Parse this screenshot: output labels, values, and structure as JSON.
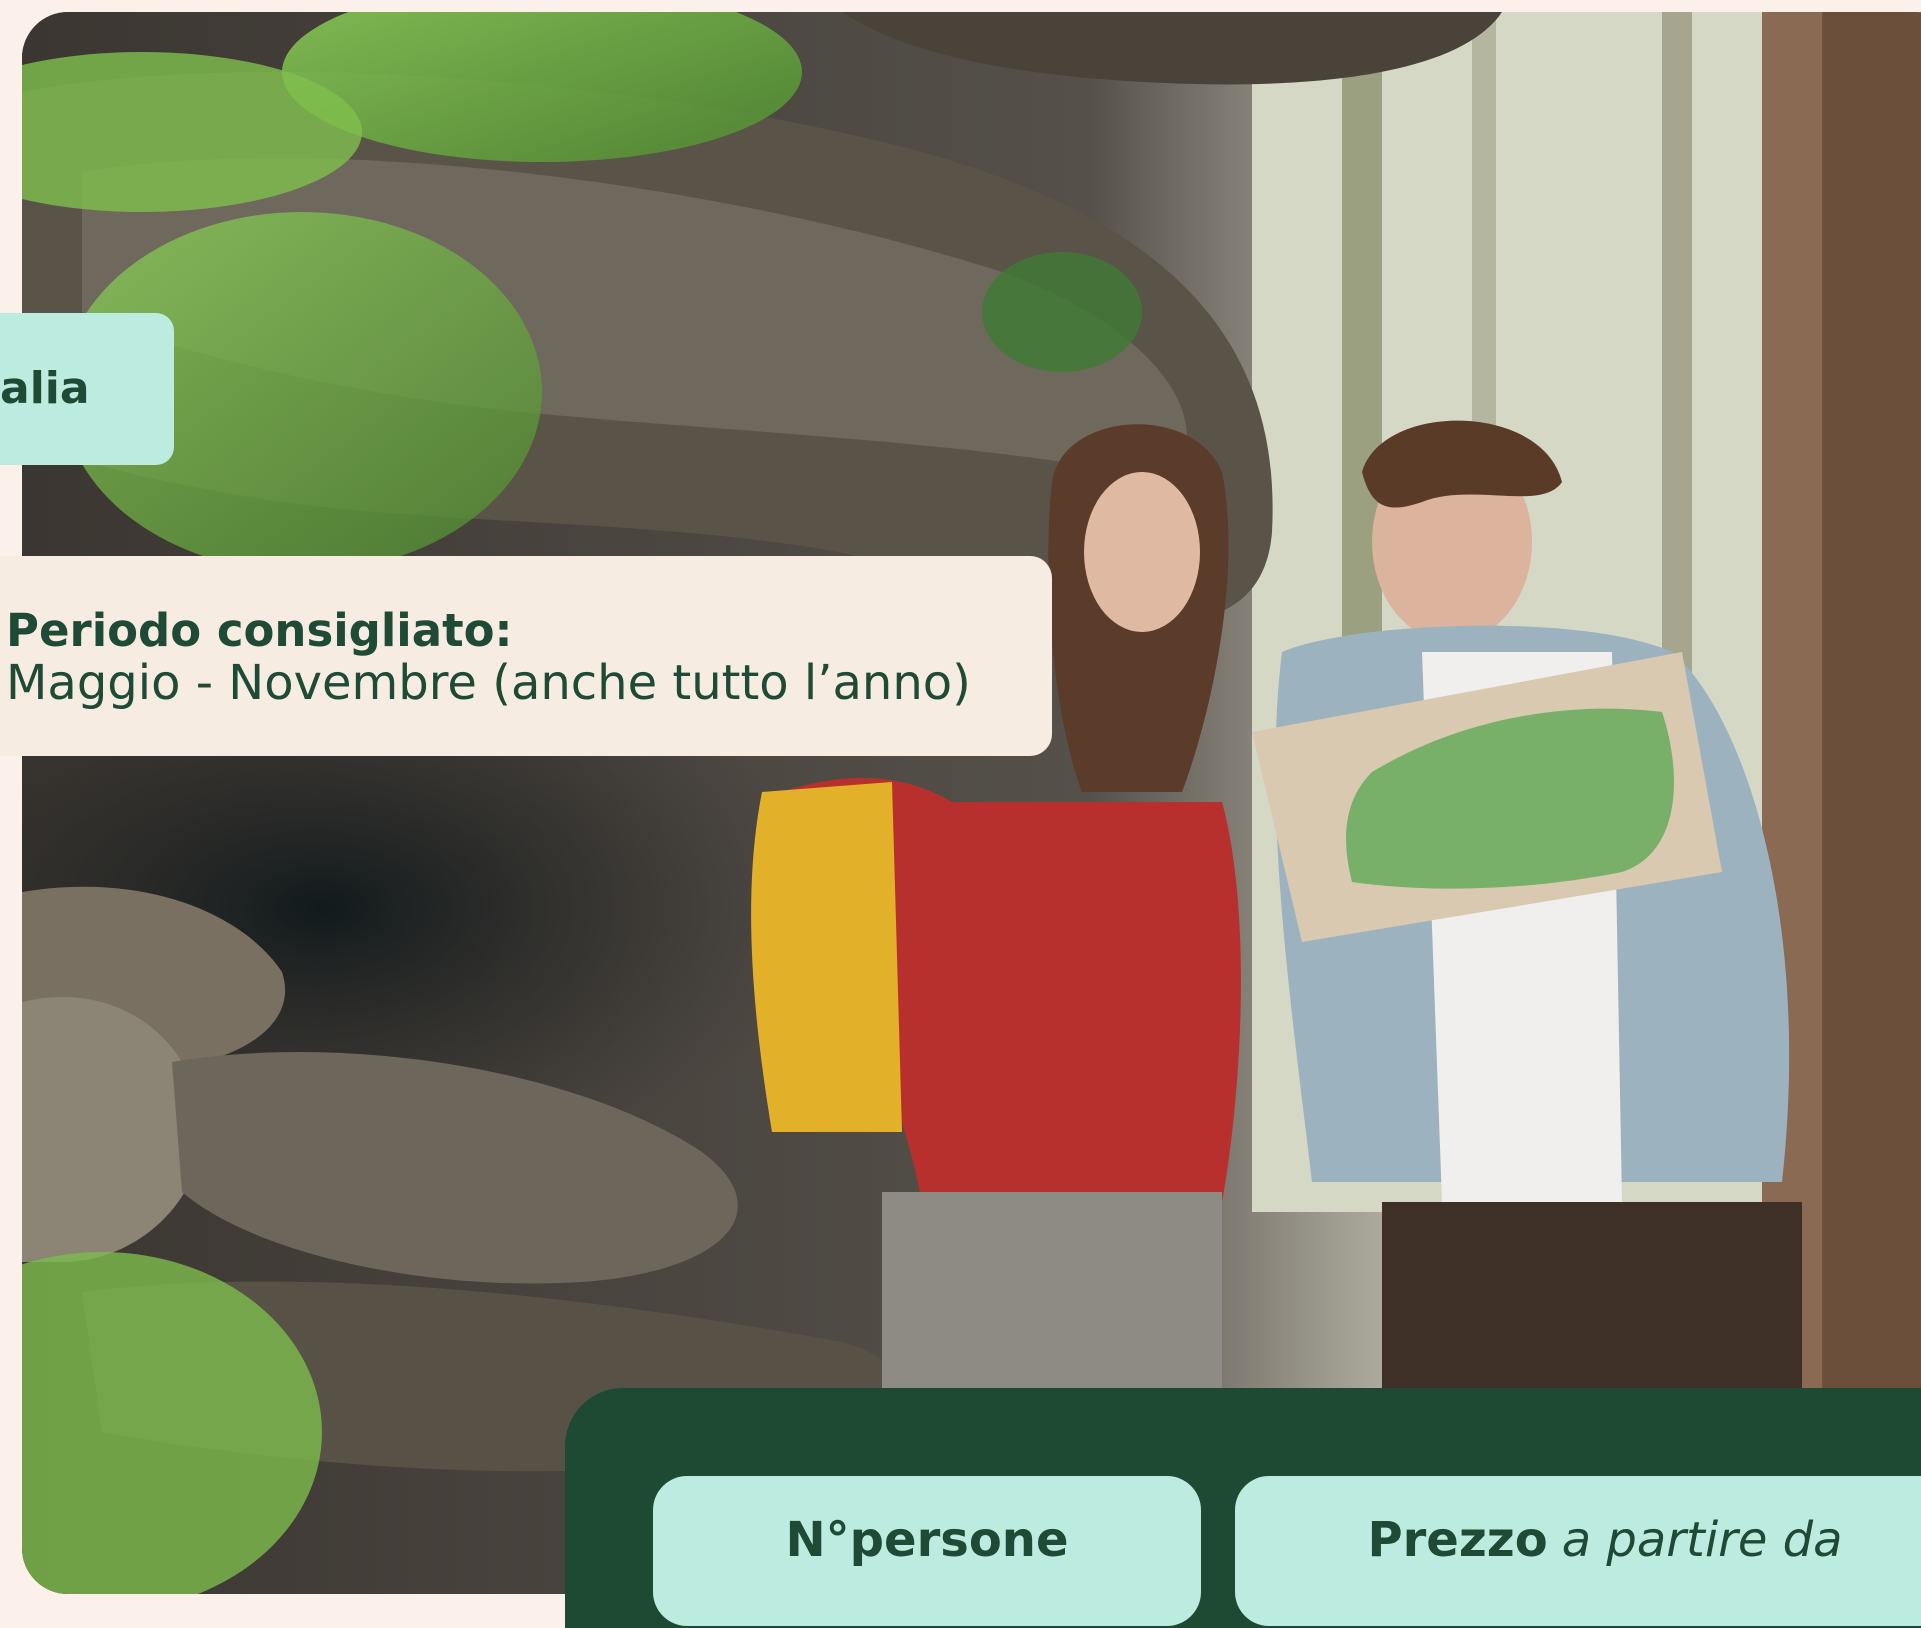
{
  "hero": {
    "image_description_icon": "hikers-forest-photo"
  },
  "location_chip": {
    "label": "alia"
  },
  "period": {
    "title": "Periodo consigliato:",
    "value": "Maggio - Novembre (anche tutto l’anno)"
  },
  "booking": {
    "persons_label": "N°persone",
    "price_label": "Prezzo",
    "price_suffix": "a partire da"
  },
  "colors": {
    "accent_dark": "#1e4a33",
    "chip_mint": "#bcece0",
    "card_cream": "#f7ece2",
    "page_bg": "#fbf1ea",
    "text_green": "#1f4a35"
  }
}
